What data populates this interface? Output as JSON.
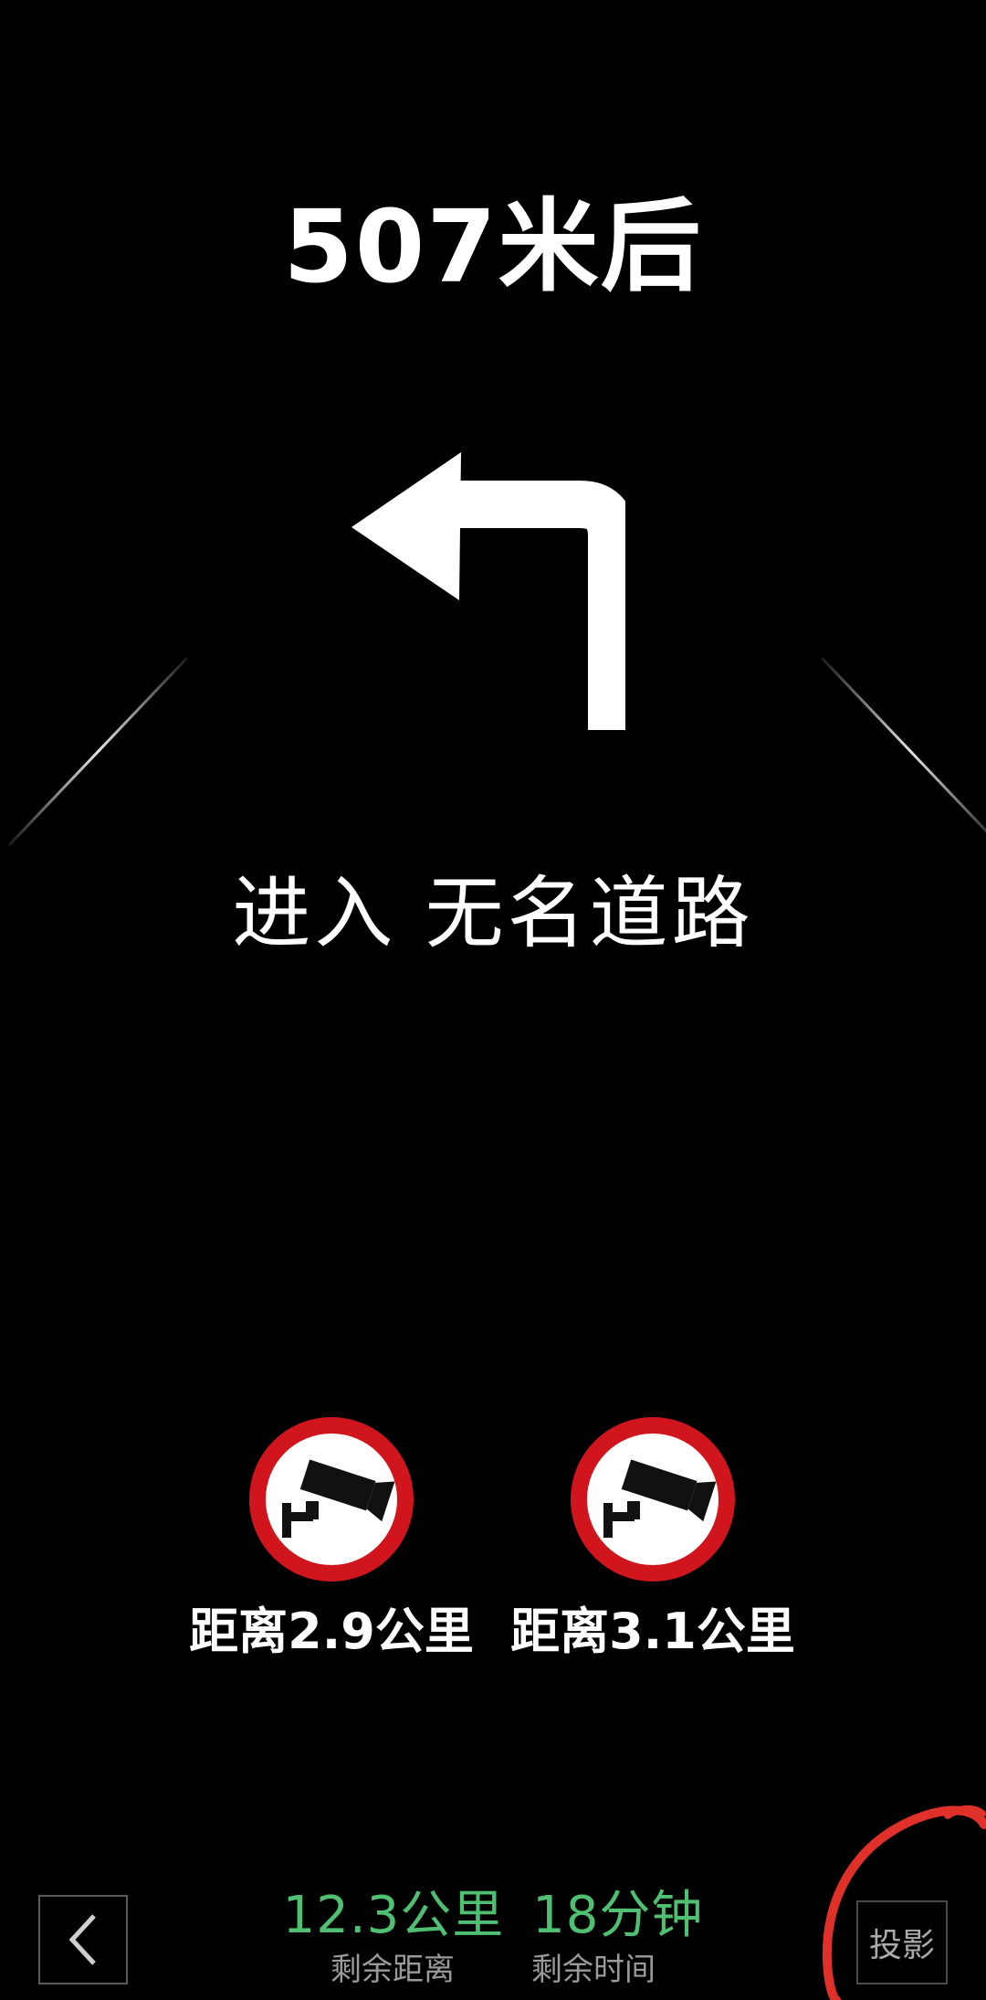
{
  "guidance": {
    "distance_text": "507米后",
    "maneuver_icon": "turn-left-arrow-icon",
    "instruction_text": "进入 无名道路"
  },
  "cameras": [
    {
      "icon": "surveillance-camera-icon",
      "label": "距离2.9公里"
    },
    {
      "icon": "surveillance-camera-icon",
      "label": "距离3.1公里"
    }
  ],
  "bottom_bar": {
    "back_icon": "chevron-left-icon",
    "remaining_distance": "12.3公里",
    "remaining_time": "18分钟",
    "remaining_distance_label": "剩余距离",
    "remaining_time_label": "剩余时间",
    "project_button_label": "投影"
  },
  "colors": {
    "background": "#000000",
    "text": "#ffffff",
    "summary_accent": "#4fbf72",
    "sign_ring": "#d0161c",
    "annotation": "#e0302a"
  }
}
